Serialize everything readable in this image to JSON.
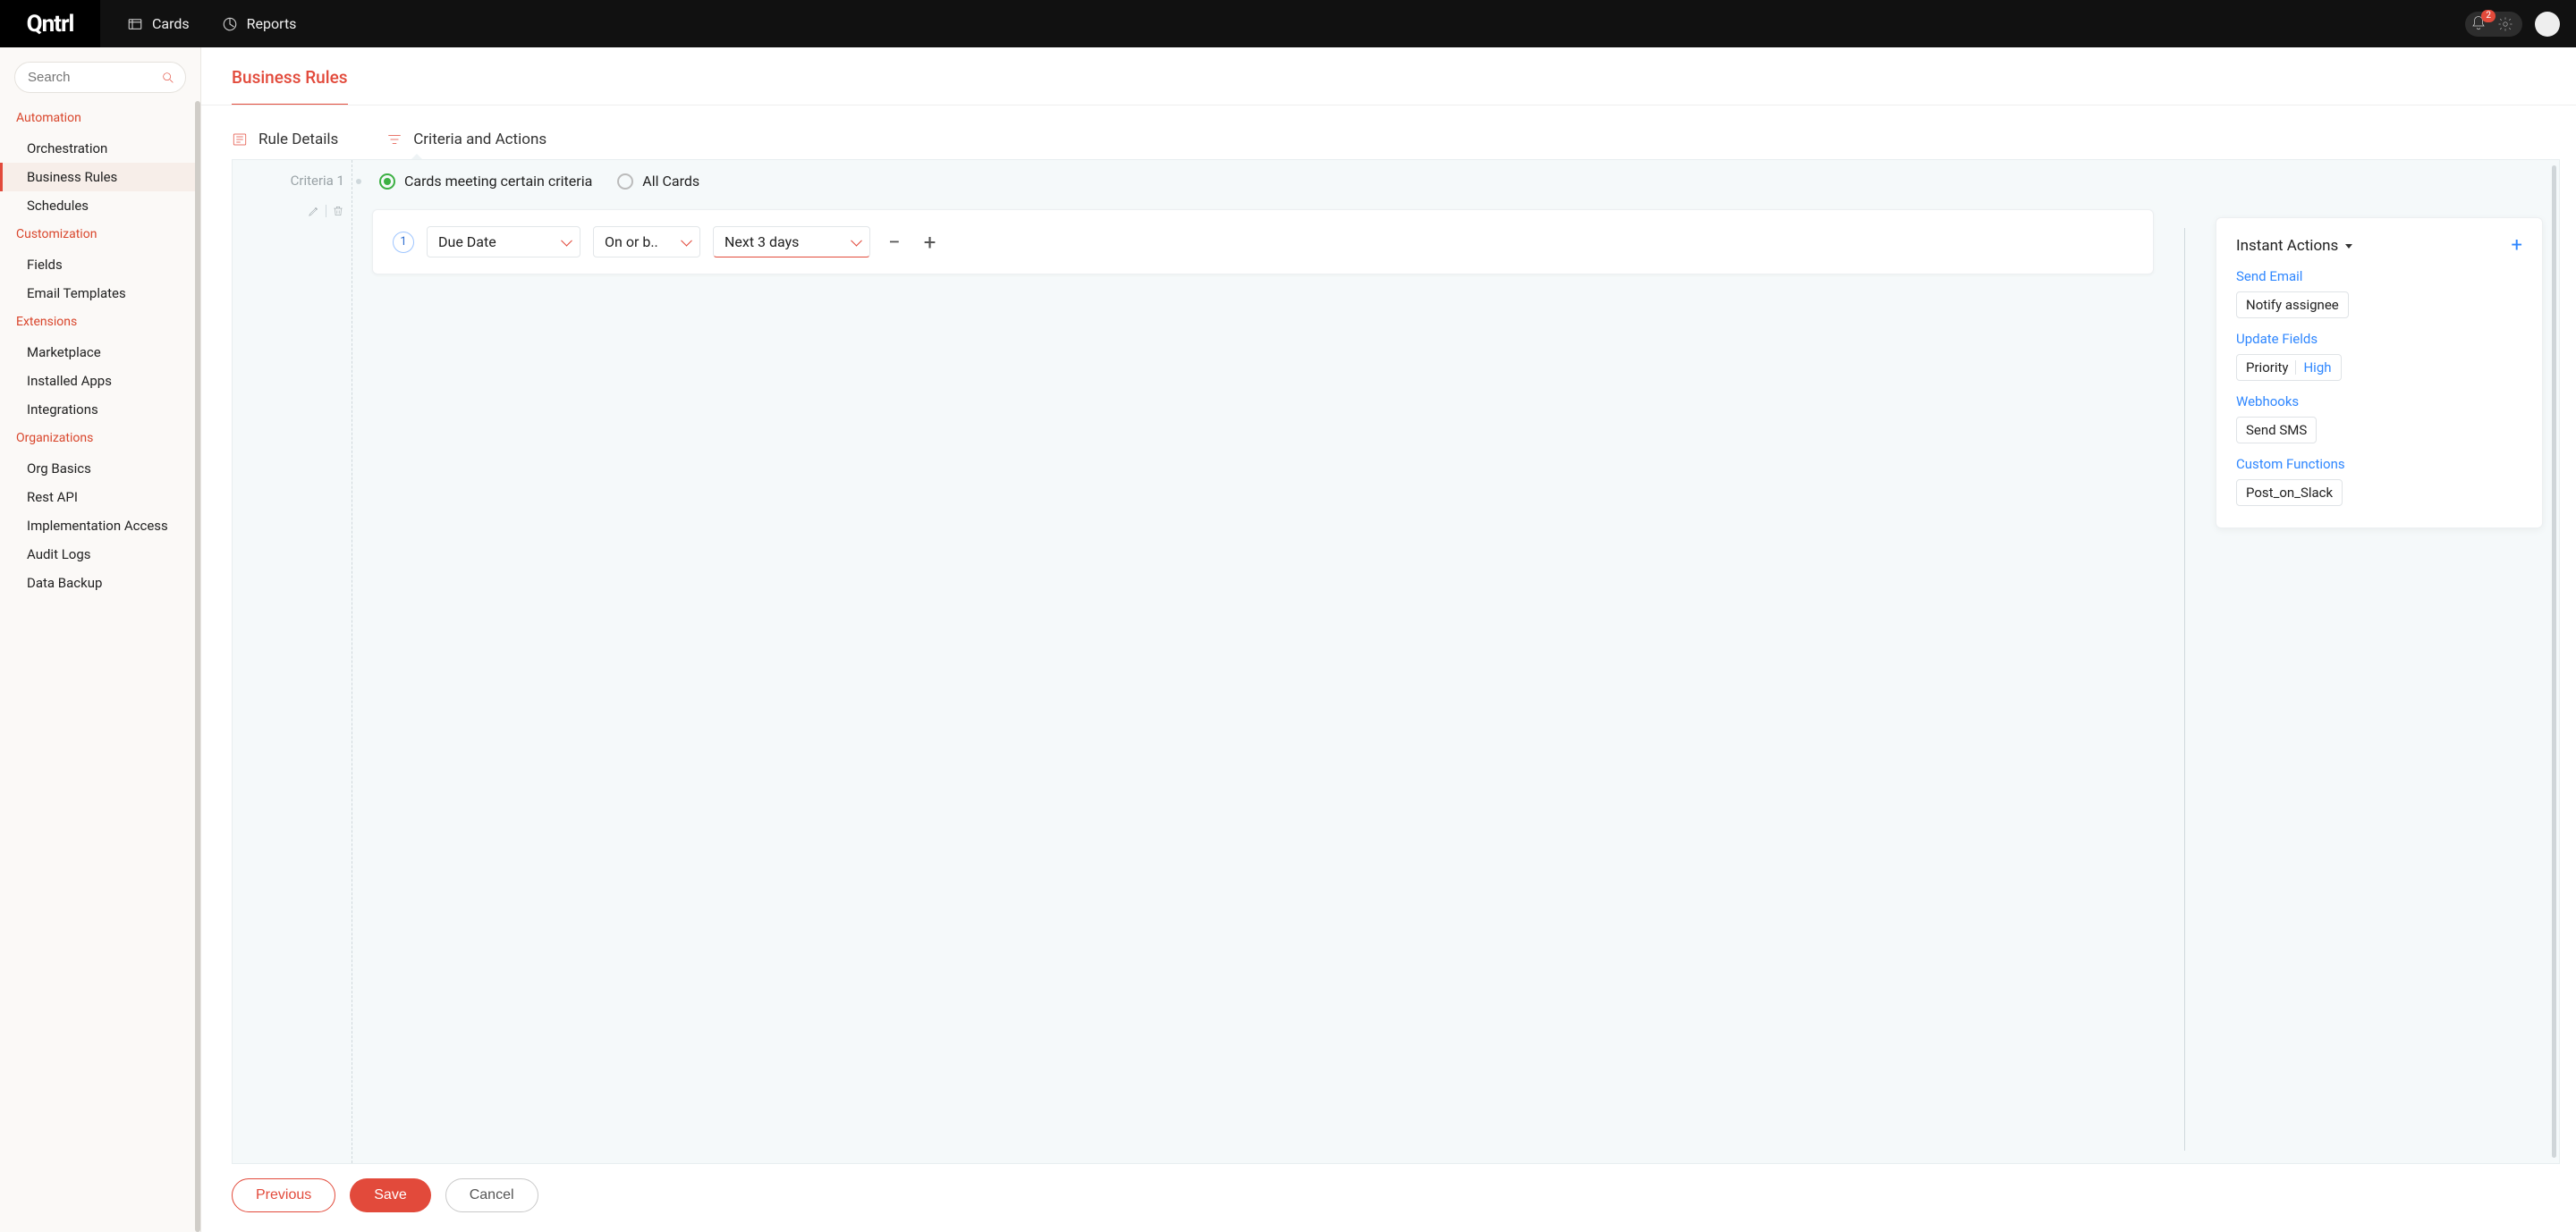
{
  "topbar": {
    "logo": "Qntrl",
    "nav": {
      "cards": "Cards",
      "reports": "Reports"
    },
    "notifications_count": "2"
  },
  "sidebar": {
    "search_placeholder": "Search",
    "sections": {
      "automation": {
        "title": "Automation",
        "items": {
          "orchestration": "Orchestration",
          "business_rules": "Business Rules",
          "schedules": "Schedules"
        }
      },
      "customization": {
        "title": "Customization",
        "items": {
          "fields": "Fields",
          "email_templates": "Email Templates"
        }
      },
      "extensions": {
        "title": "Extensions",
        "items": {
          "marketplace": "Marketplace",
          "installed_apps": "Installed Apps",
          "integrations": "Integrations"
        }
      },
      "organizations": {
        "title": "Organizations",
        "items": {
          "org_basics": "Org Basics",
          "rest_api": "Rest API",
          "implementation_access": "Implementation Access",
          "audit_logs": "Audit Logs",
          "data_backup": "Data Backup"
        }
      }
    }
  },
  "page": {
    "title": "Business Rules",
    "tabs": {
      "details": "Rule Details",
      "criteria": "Criteria and Actions"
    },
    "criteria_label": "Criteria 1",
    "scope": {
      "certain": "Cards meeting certain criteria",
      "all": "All Cards"
    },
    "rule": {
      "step": "1",
      "field": "Due Date",
      "operator": "On or b..",
      "value": "Next 3 days"
    },
    "actions": {
      "title": "Instant Actions",
      "send_email": {
        "title": "Send Email",
        "chip": "Notify assignee"
      },
      "update_fields": {
        "title": "Update Fields",
        "field": "Priority",
        "value": "High"
      },
      "webhooks": {
        "title": "Webhooks",
        "chip": "Send SMS"
      },
      "custom_functions": {
        "title": "Custom Functions",
        "chip": "Post_on_Slack"
      }
    },
    "footer": {
      "previous": "Previous",
      "save": "Save",
      "cancel": "Cancel"
    }
  }
}
